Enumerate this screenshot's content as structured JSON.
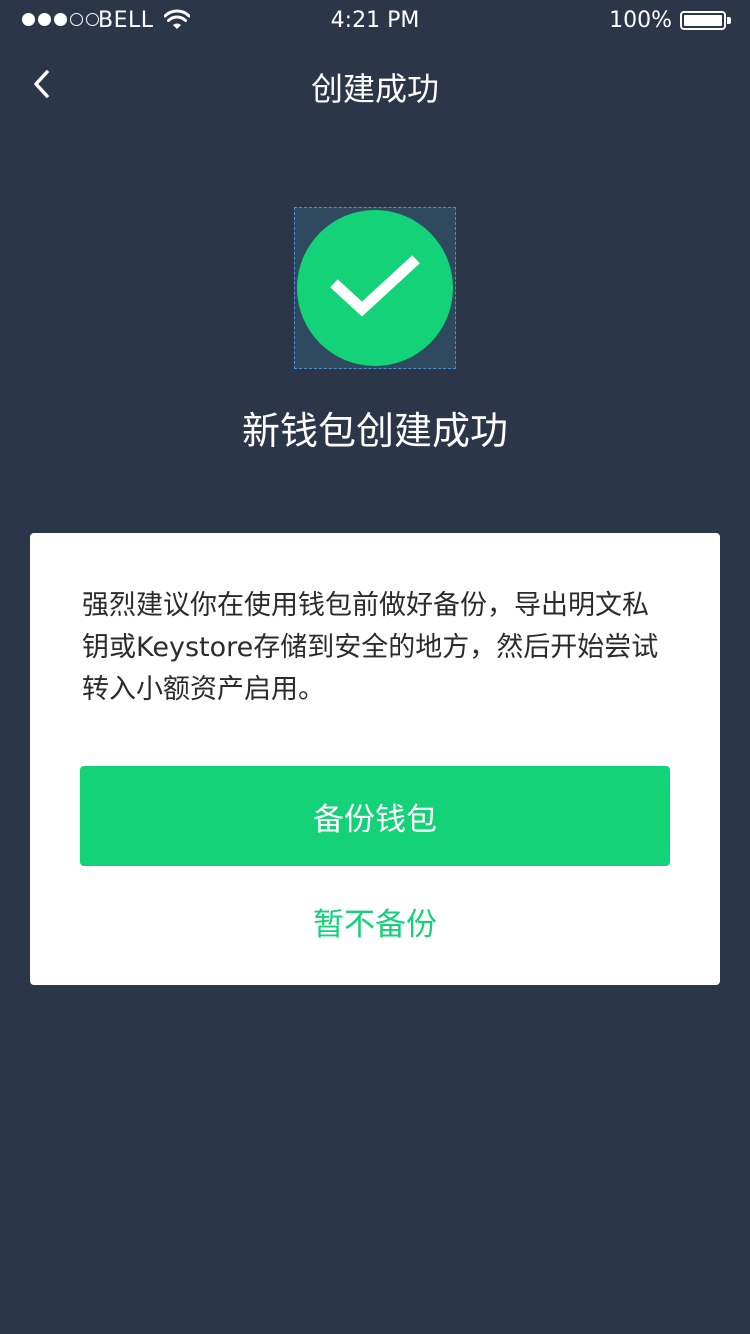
{
  "status_bar": {
    "carrier": "BELL",
    "time": "4:21 PM",
    "battery": "100%",
    "signal_filled": 3,
    "signal_total": 5
  },
  "nav": {
    "title": "创建成功",
    "back_icon": "chevron-left-icon"
  },
  "success": {
    "icon": "checkmark-icon",
    "title": "新钱包创建成功"
  },
  "card": {
    "message": "强烈建议你在使用钱包前做好备份，导出明文私钥或Keystore存储到安全的地方，然后开始尝试转入小额资产启用。",
    "primary_button": "备份钱包",
    "secondary_link": "暂不备份"
  },
  "colors": {
    "background": "#2c3649",
    "accent_green": "#13d277",
    "card_bg": "#ffffff"
  }
}
